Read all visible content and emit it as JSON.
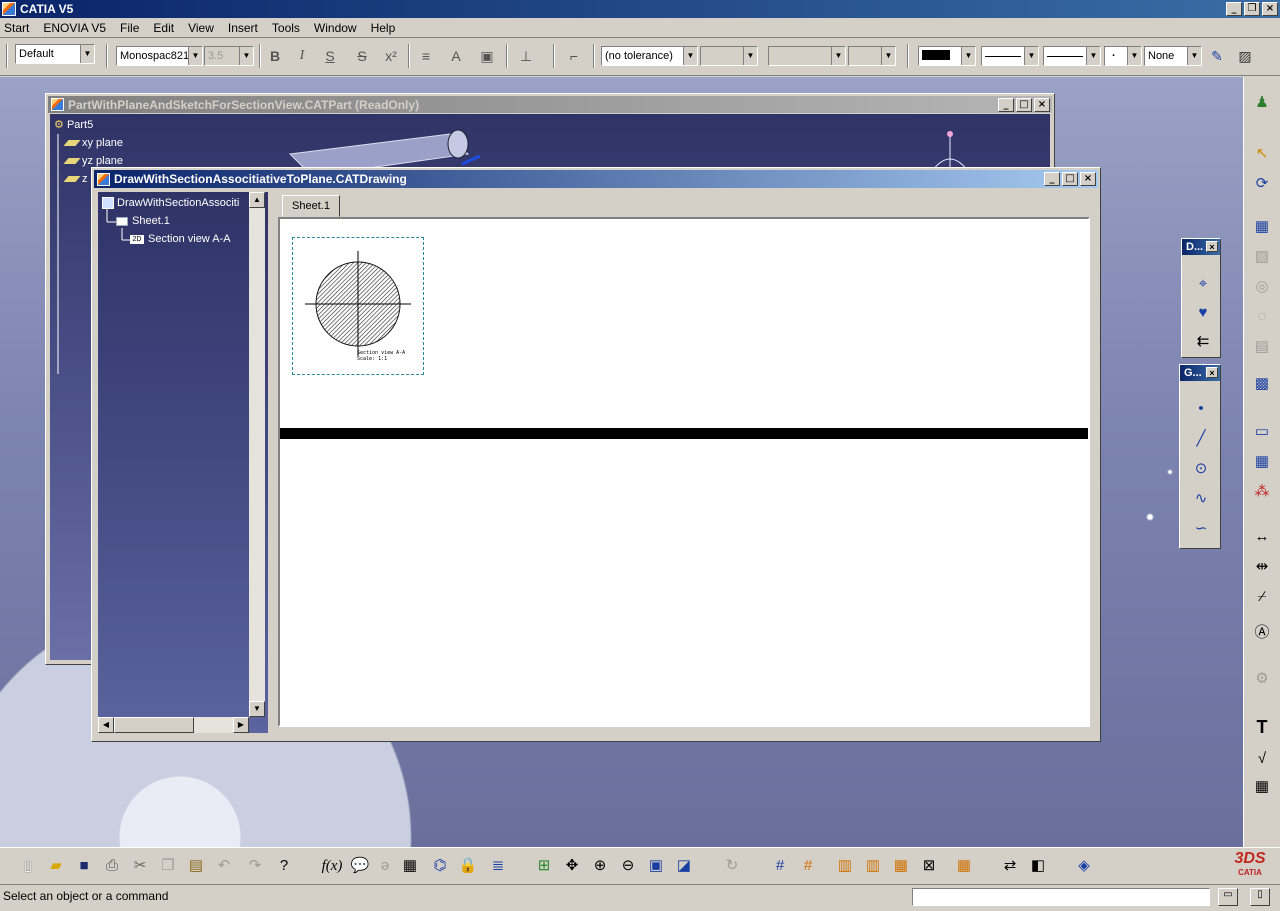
{
  "app": {
    "title": "CATIA V5"
  },
  "menu": {
    "items": [
      "Start",
      "ENOVIA V5",
      "File",
      "Edit",
      "View",
      "Insert",
      "Tools",
      "Window",
      "Help"
    ]
  },
  "format_toolbar": {
    "style": "Default",
    "font": "Monospac821",
    "font_size": "3.5",
    "tolerance": "(no tolerance)",
    "pattern": "None"
  },
  "part_window": {
    "title": "PartWithPlaneAndSketchForSectionView.CATPart (ReadOnly)",
    "tree": [
      "Part5",
      "xy plane",
      "yz plane",
      "z"
    ]
  },
  "drawing_window": {
    "title": "DrawWithSectionAssocitiativeToPlane.CATDrawing",
    "tree": [
      "DrawWithSectionAssociti",
      "Sheet.1",
      "Section view A-A"
    ],
    "tab": "Sheet.1",
    "view_label": "Section view A-A",
    "view_scale": "Scale: 1:1"
  },
  "float_toolbars": {
    "dress_up": "D...",
    "geometry": "G..."
  },
  "status": {
    "message": "Select an object or a command",
    "command_value": ""
  },
  "logo": {
    "text": "CATIA"
  }
}
